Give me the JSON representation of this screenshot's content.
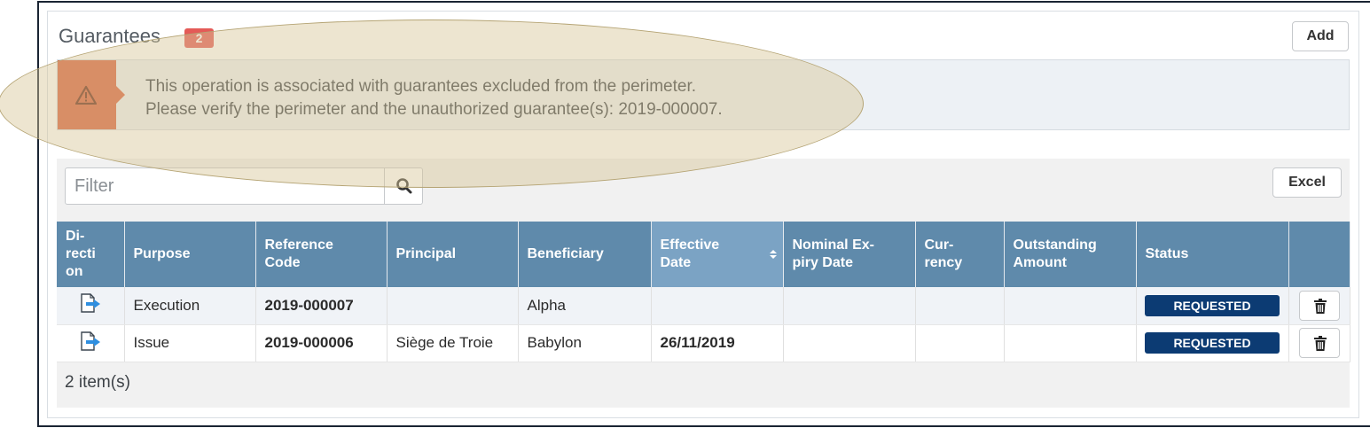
{
  "section": {
    "title": "Guarantees",
    "count": "2",
    "add_label": "Add"
  },
  "alert": {
    "line1": "This operation is associated with guarantees excluded from the perimeter.",
    "line2": "Please verify the perimeter and the unauthorized guarantee(s): 2019-000007.",
    "icon": "warning-icon",
    "color": "#d9613f"
  },
  "toolbar": {
    "filter_placeholder": "Filter",
    "filter_value": "",
    "excel_label": "Excel"
  },
  "table": {
    "columns": [
      "Di-\nrecti\non",
      "Purpose",
      "Reference\nCode",
      "Principal",
      "Beneficiary",
      "Effective\nDate",
      "Nominal Ex-\npiry Date",
      "Cur-\nrency",
      "Outstanding\nAmount",
      "Status",
      ""
    ],
    "rows": [
      {
        "direction_icon": "outgoing-arrow-icon",
        "purpose": "Execution",
        "reference": "2019-000007",
        "principal": "",
        "beneficiary": "Alpha",
        "effective_date": "",
        "expiry_date": "",
        "currency": "",
        "amount": "",
        "status": "REQUESTED"
      },
      {
        "direction_icon": "outgoing-arrow-icon",
        "purpose": "Issue",
        "reference": "2019-000006",
        "principal": "Siège de Troie",
        "beneficiary": "Babylon",
        "effective_date": "26/11/2019",
        "expiry_date": "",
        "currency": "",
        "amount": "",
        "status": "REQUESTED"
      }
    ]
  },
  "footer": {
    "count_text": "2 item(s)"
  },
  "colors": {
    "header_bg": "#5f8aab",
    "sorted_header_bg": "#7ba3c4",
    "status_bg": "#0c3b73",
    "badge_bg": "#e45a57",
    "highlight": "#d6c696"
  }
}
